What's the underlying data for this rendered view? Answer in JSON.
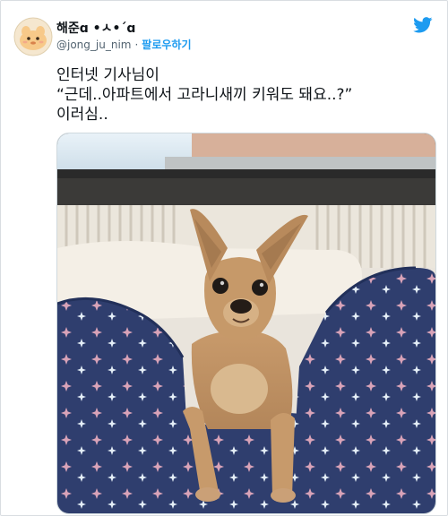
{
  "author": {
    "display_name": "해준ɑ •ㅅ•´ɑ",
    "handle": "@jong_ju_nim",
    "separator": "·",
    "follow_label": "팔로우하기"
  },
  "tweet": {
    "lines": [
      "인터넷 기사님이",
      "“근데..아파트에서 고라니새끼 키워도 돼요..?”",
      "이러심.."
    ]
  },
  "icons": {
    "brand": "twitter-bird-icon",
    "avatar": "cartoon-avatar"
  },
  "colors": {
    "accent": "#1d9bf0",
    "text": "#0f1419",
    "secondary": "#536471",
    "blanket": "#2f3e6e"
  }
}
